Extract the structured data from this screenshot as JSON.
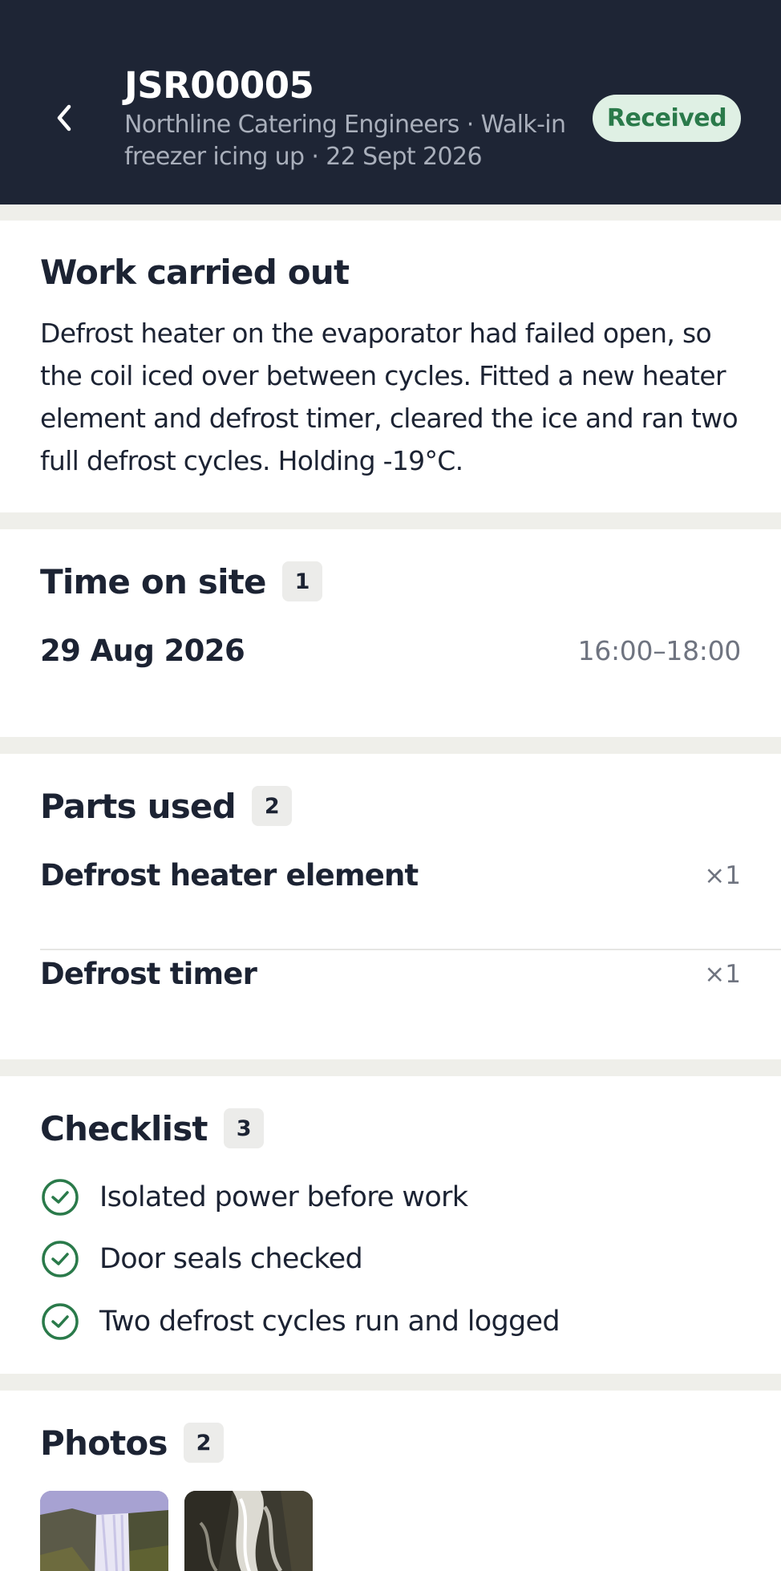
{
  "header": {
    "back_icon": "chevron-left-icon",
    "title": "JSR00005",
    "subtitle": "Northline Catering Engineers · Walk-in freezer icing up · 22 Sept 2026",
    "status": "Received",
    "status_color": "#2a7a4a"
  },
  "work": {
    "title": "Work carried out",
    "text": "Defrost heater on the evaporator had failed open, so the coil iced over between cycles. Fitted a new heater element and defrost timer, cleared the ice and ran two full defrost cycles. Holding -19°C."
  },
  "time_on_site": {
    "title": "Time on site",
    "count": "1",
    "entries": [
      {
        "date": "29 Aug 2026",
        "time": "16:00–18:00"
      }
    ]
  },
  "parts": {
    "title": "Parts used",
    "count": "2",
    "items": [
      {
        "name": "Defrost heater element",
        "qty": "×1"
      },
      {
        "name": "Defrost timer",
        "qty": "×1"
      }
    ]
  },
  "checklist": {
    "title": "Checklist",
    "count": "3",
    "check_color": "#2a7a4a",
    "items": [
      {
        "label": "Isolated power before work",
        "icon": "check-circle-icon"
      },
      {
        "label": "Door seals checked",
        "icon": "check-circle-icon"
      },
      {
        "label": "Two defrost cycles run and logged",
        "icon": "check-circle-icon"
      }
    ]
  },
  "photos": {
    "title": "Photos",
    "count": "2"
  }
}
